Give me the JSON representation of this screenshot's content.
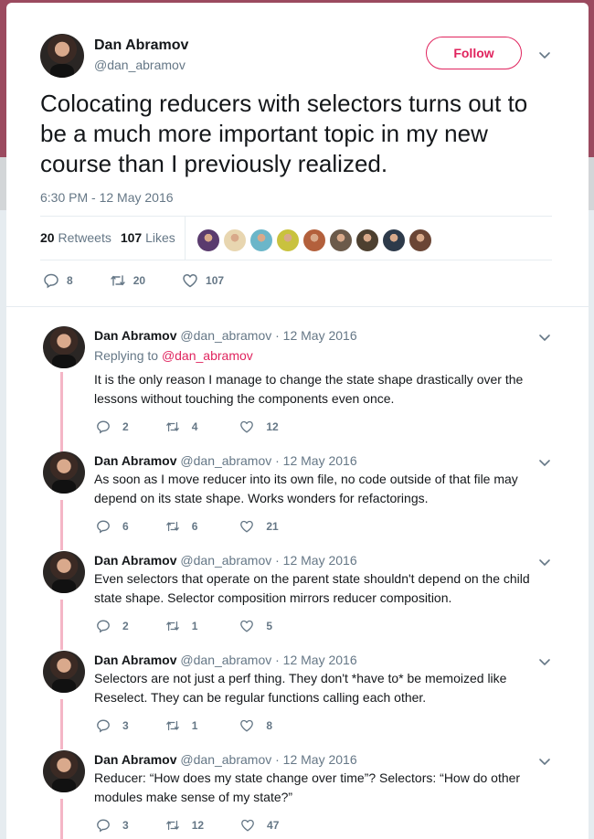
{
  "tweet": {
    "author_name": "Dan Abramov",
    "author_handle": "@dan_abramov",
    "follow_label": "Follow",
    "text": "Colocating reducers with selectors turns out to be a much more important topic in my new course than I previously realized.",
    "timestamp": "6:30 PM - 12 May 2016",
    "retweets_count": "20",
    "retweets_label": "Retweets",
    "likes_count": "107",
    "likes_label": "Likes",
    "actions": {
      "replies": "8",
      "retweets": "20",
      "likes": "107"
    },
    "liker_avatar_colors": [
      "#5a3b6e",
      "#e8d6b0",
      "#6bb6c9",
      "#c9c23e",
      "#b3603c",
      "#6b5a4a",
      "#4d4030",
      "#2d3a4a",
      "#6a4535"
    ]
  },
  "replies": [
    {
      "name": "Dan Abramov",
      "handle": "@dan_abramov",
      "date": "· 12 May 2016",
      "replying_prefix": "Replying to",
      "replying_to": "@dan_abramov",
      "text": "It is the only reason I manage to change the state shape drastically over the lessons without touching the components even once.",
      "replies": "2",
      "retweets": "4",
      "likes": "12"
    },
    {
      "name": "Dan Abramov",
      "handle": "@dan_abramov",
      "date": "· 12 May 2016",
      "text": "As soon as I move reducer into its own file, no code outside of that file may depend on its state shape. Works wonders for refactorings.",
      "replies": "6",
      "retweets": "6",
      "likes": "21"
    },
    {
      "name": "Dan Abramov",
      "handle": "@dan_abramov",
      "date": "· 12 May 2016",
      "text": "Even selectors that operate on the parent state shouldn't depend on the child state shape. Selector composition mirrors reducer composition.",
      "replies": "2",
      "retweets": "1",
      "likes": "5"
    },
    {
      "name": "Dan Abramov",
      "handle": "@dan_abramov",
      "date": "· 12 May 2016",
      "text": "Selectors are not just a perf thing. They don't *have to* be memoized like Reselect. They can be regular functions calling each other.",
      "replies": "3",
      "retweets": "1",
      "likes": "8"
    },
    {
      "name": "Dan Abramov",
      "handle": "@dan_abramov",
      "date": "· 12 May 2016",
      "text": "Reducer: “How does my state change over time”? Selectors: “How do other modules make sense of my state?”",
      "replies": "3",
      "retweets": "12",
      "likes": "47"
    }
  ]
}
